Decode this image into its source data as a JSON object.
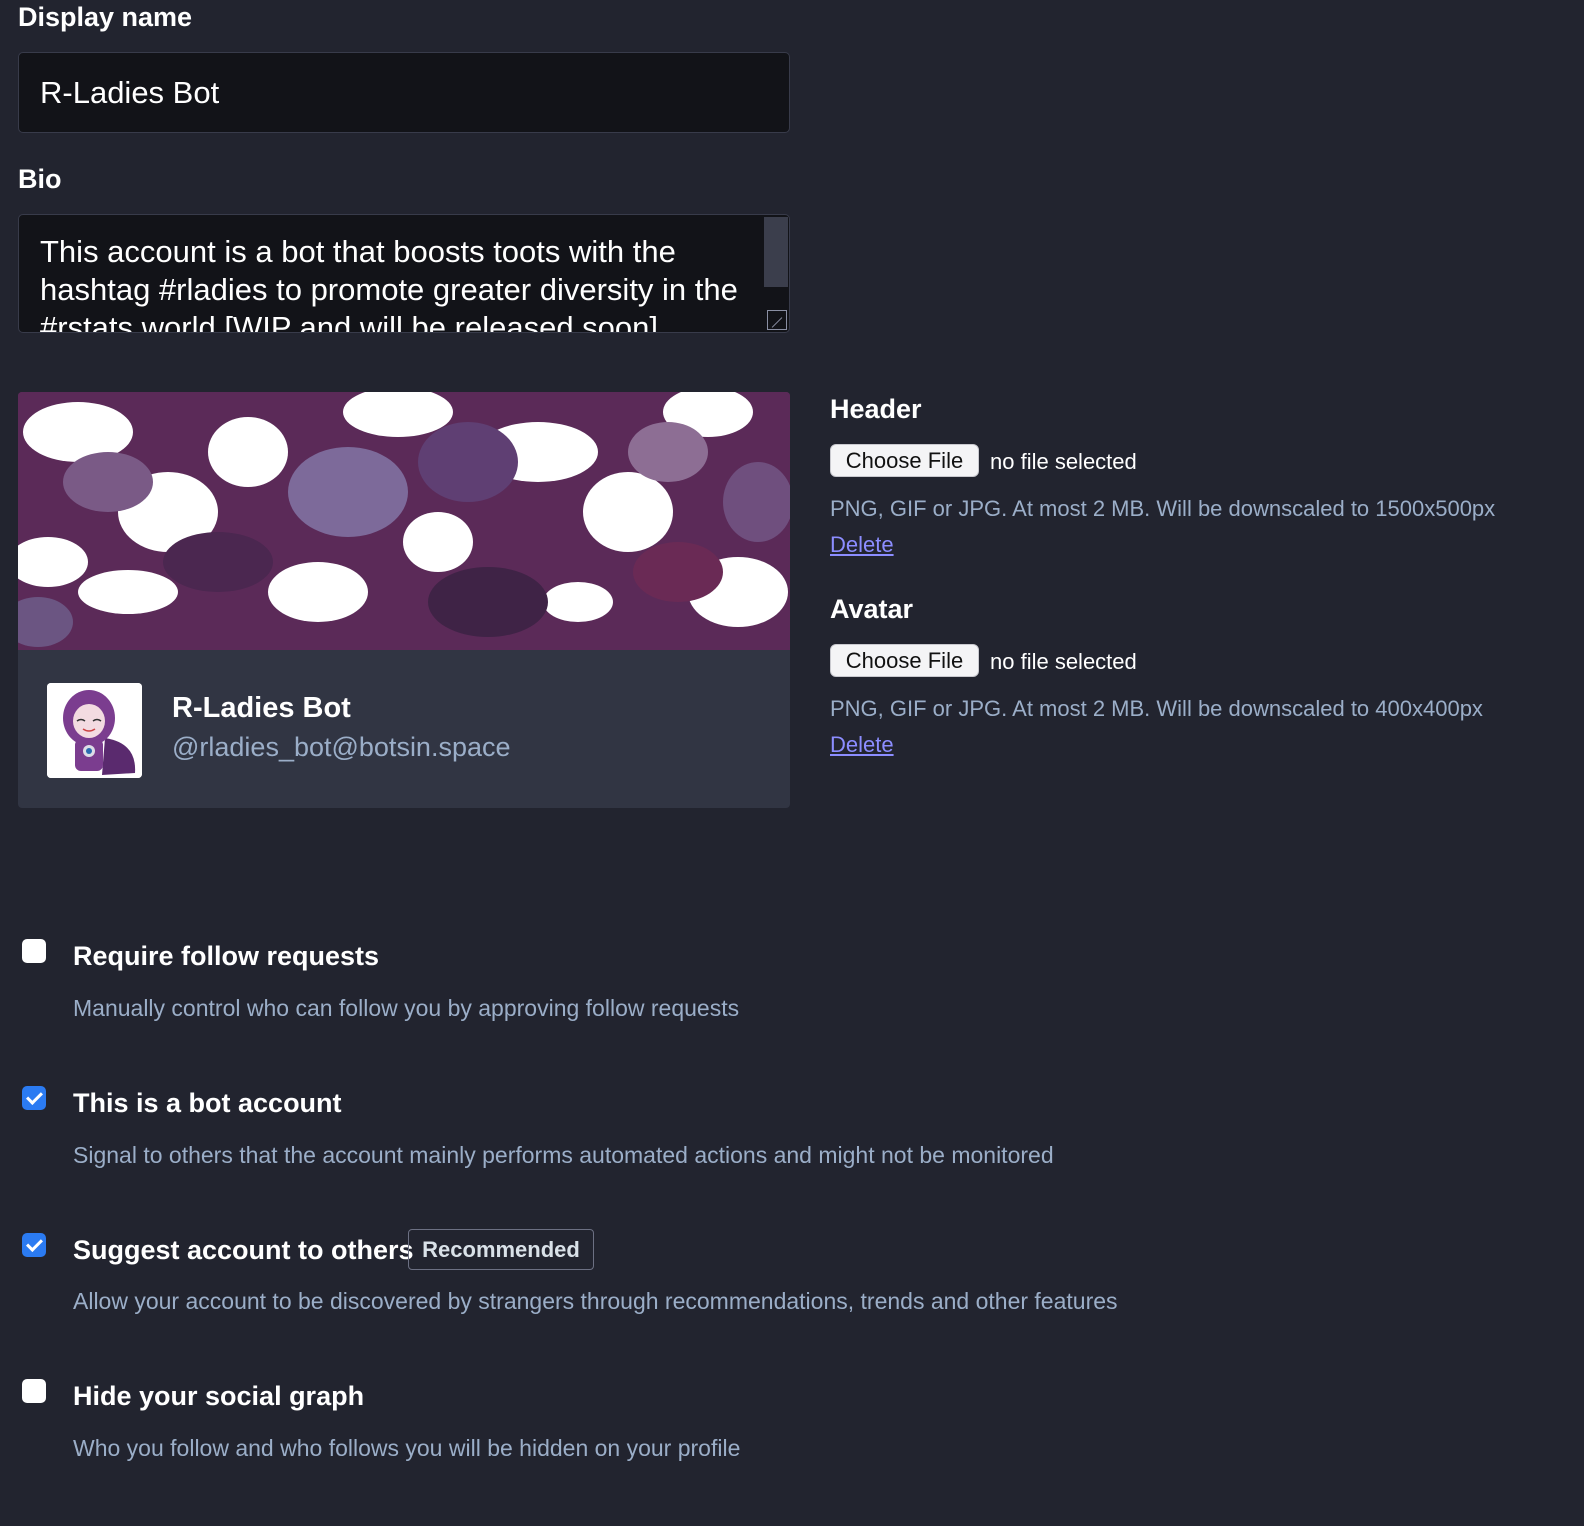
{
  "display_name": {
    "label": "Display name",
    "value": "R-Ladies Bot"
  },
  "bio": {
    "label": "Bio",
    "value": "This account is a bot that boosts toots with the hashtag #rladies to promote greater diversity in the #rstats world [WIP and will be released soon]"
  },
  "preview": {
    "name": "R-Ladies Bot",
    "handle": "@rladies_bot@botsin.space"
  },
  "header_upload": {
    "label": "Header",
    "button": "Choose File",
    "status": "no file selected",
    "hint": "PNG, GIF or JPG. At most 2 MB. Will be downscaled to 1500x500px",
    "delete": "Delete"
  },
  "avatar_upload": {
    "label": "Avatar",
    "button": "Choose File",
    "status": "no file selected",
    "hint": "PNG, GIF or JPG. At most 2 MB. Will be downscaled to 400x400px",
    "delete": "Delete"
  },
  "options": [
    {
      "title": "Require follow requests",
      "hint": "Manually control who can follow you by approving follow requests",
      "checked": false
    },
    {
      "title": "This is a bot account",
      "hint": "Signal to others that the account mainly performs automated actions and might not be monitored",
      "checked": true
    },
    {
      "title": "Suggest account to others",
      "badge": "Recommended",
      "hint": "Allow your account to be discovered by strangers through recommendations, trends and other features",
      "checked": true
    },
    {
      "title": "Hide your social graph",
      "hint": "Who you follow and who follows you will be hidden on your profile",
      "checked": false
    }
  ],
  "colors": {
    "background": "#22242f",
    "checkbox_checked": "#2b7bf2",
    "link": "#8c8dff",
    "hint_text": "#9baec8"
  }
}
